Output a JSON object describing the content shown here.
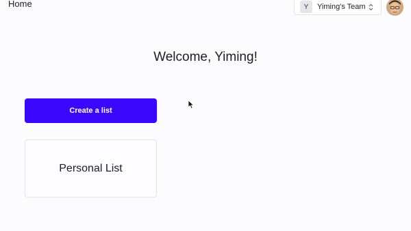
{
  "header": {
    "page_title": "Home",
    "team": {
      "initial": "Y",
      "name": "Yiming's Team"
    }
  },
  "main": {
    "welcome": "Welcome, Yiming!",
    "create_button_label": "Create a list",
    "lists": [
      {
        "name": "Personal List"
      }
    ]
  },
  "colors": {
    "accent": "#3a08ff",
    "background": "#fcfbfe",
    "card_border": "#e3e2e9"
  }
}
